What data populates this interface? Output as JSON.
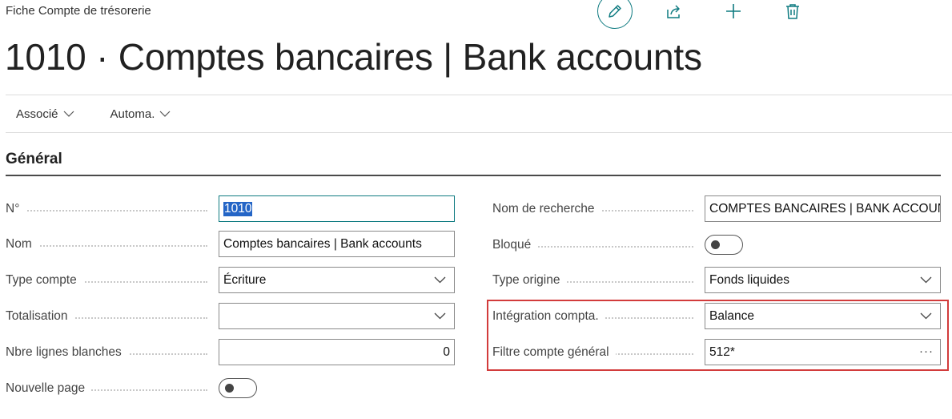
{
  "page": {
    "caption": "Fiche Compte de trésorerie",
    "title": "1010 · Comptes bancaires | Bank accounts"
  },
  "toolbar": {
    "edit_icon": "pencil-icon",
    "share_icon": "share-icon",
    "add_icon": "plus-icon",
    "delete_icon": "trash-icon"
  },
  "actions": [
    {
      "label": "Associé"
    },
    {
      "label": "Automa."
    }
  ],
  "section": {
    "title": "Général"
  },
  "left_fields": {
    "no": {
      "label": "N°",
      "value": "1010"
    },
    "name": {
      "label": "Nom",
      "value": "Comptes bancaires | Bank accounts"
    },
    "account_type": {
      "label": "Type compte",
      "value": "Écriture"
    },
    "totaling": {
      "label": "Totalisation",
      "value": ""
    },
    "blank_lines": {
      "label": "Nbre lignes blanches",
      "value": "0"
    },
    "new_page": {
      "label": "Nouvelle page",
      "value": false
    }
  },
  "right_fields": {
    "search_name": {
      "label": "Nom de recherche",
      "value": "COMPTES BANCAIRES | BANK ACCOUNTS"
    },
    "blocked": {
      "label": "Bloqué",
      "value": false
    },
    "origin_type": {
      "label": "Type origine",
      "value": "Fonds liquides"
    },
    "posting_integration": {
      "label": "Intégration compta.",
      "value": "Balance"
    },
    "gl_account_filter": {
      "label": "Filtre compte général",
      "value": "512*"
    }
  },
  "colors": {
    "accent": "#0f7b81",
    "selection": "#2465c6",
    "highlight": "#d23b3b"
  }
}
